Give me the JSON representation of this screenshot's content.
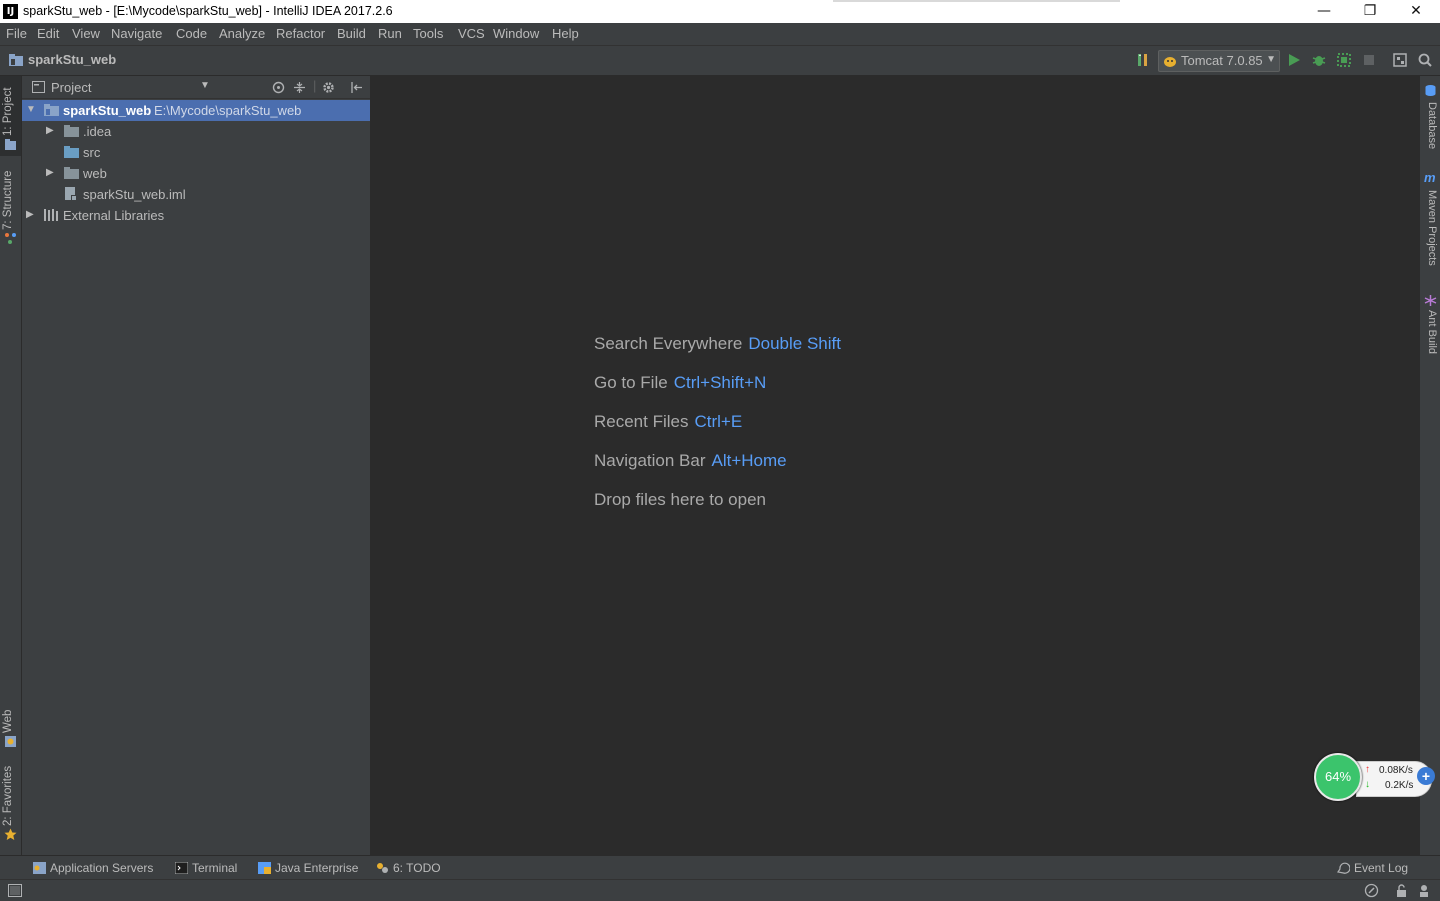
{
  "window": {
    "title": "sparkStu_web - [E:\\Mycode\\sparkStu_web] - IntelliJ IDEA 2017.2.6",
    "app_icon": "IJ",
    "controls": {
      "minimize": "—",
      "maximize": "❐",
      "close": "✕"
    }
  },
  "menu": [
    "File",
    "Edit",
    "View",
    "Navigate",
    "Code",
    "Analyze",
    "Refactor",
    "Build",
    "Run",
    "Tools",
    "VCS",
    "Window",
    "Help"
  ],
  "navbar": {
    "project": "sparkStu_web"
  },
  "run_config": {
    "name": "Tomcat 7.0.85"
  },
  "left_tabs": {
    "project": "1: Project",
    "structure": "7: Structure",
    "web": "Web",
    "favorites": "2: Favorites"
  },
  "right_tabs": {
    "database": "Database",
    "maven": "Maven Projects",
    "ant": "Ant Build"
  },
  "project_panel": {
    "title": "Project",
    "tree": [
      {
        "name": "sparkStu_web",
        "path": "E:\\Mycode\\sparkStu_web",
        "expanded": true,
        "selected": true,
        "icon": "module-folder-icon"
      },
      {
        "name": ".idea",
        "collapsed": true,
        "icon": "folder-icon"
      },
      {
        "name": "src",
        "icon": "folder-icon"
      },
      {
        "name": "web",
        "collapsed": true,
        "icon": "folder-icon"
      },
      {
        "name": "sparkStu_web.iml",
        "icon": "iml-file-icon"
      },
      {
        "name": "External Libraries",
        "collapsed": true,
        "icon": "libraries-icon"
      }
    ]
  },
  "editor_hints": [
    {
      "label": "Search Everywhere",
      "key": "Double Shift"
    },
    {
      "label": "Go to File",
      "key": "Ctrl+Shift+N"
    },
    {
      "label": "Recent Files",
      "key": "Ctrl+E"
    },
    {
      "label": "Navigation Bar",
      "key": "Alt+Home"
    },
    {
      "label": "Drop files here to open",
      "key": ""
    }
  ],
  "net_widget": {
    "percent": "64%",
    "upload": "0.08K/s",
    "download": "0.2K/s"
  },
  "bottom_tabs": {
    "app_servers": "Application Servers",
    "terminal": "Terminal",
    "java_enterprise": "Java Enterprise",
    "todo": "6: TODO",
    "event_log": "Event Log"
  },
  "colors": {
    "accent": "#589df6",
    "selection": "#4b6eaf",
    "background": "#2b2b2b",
    "panel": "#3c3f41"
  }
}
